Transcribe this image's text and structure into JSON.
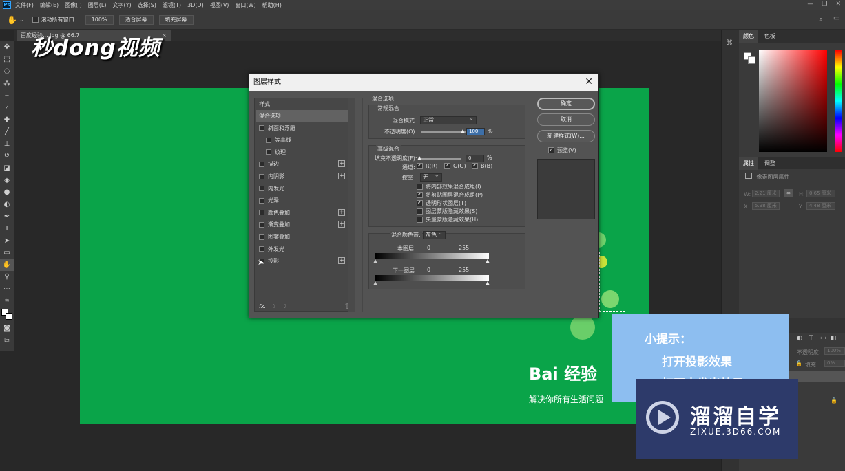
{
  "menubar": {
    "app_icon": "Ps",
    "items": [
      "文件(F)",
      "编辑(E)",
      "图像(I)",
      "图层(L)",
      "文字(Y)",
      "选择(S)",
      "滤镜(T)",
      "3D(D)",
      "视图(V)",
      "窗口(W)",
      "帮助(H)"
    ]
  },
  "options_bar": {
    "scroll_all_label": "滚动所有窗口",
    "zoom_value": "100%",
    "fit_screen": "适合屏幕",
    "fill_screen": "填充屏幕"
  },
  "document_tab": {
    "label": "百度经验... jpg @ 66.7",
    "close": "×"
  },
  "watermark": {
    "text": "秒dong视频"
  },
  "canvas": {
    "brand_text": "Bai 经验",
    "slogan": "解决你所有生活问题"
  },
  "right_panel": {
    "color_tabs": [
      "颜色",
      "色板"
    ],
    "prop_tabs": [
      "属性",
      "调整"
    ],
    "prop_title": "像素图层属性",
    "fields": [
      {
        "label": "W:",
        "value": "2.21 厘米"
      },
      {
        "label": "H:",
        "value": "0.65 厘米"
      },
      {
        "label": "X:",
        "value": "5.98 厘米"
      },
      {
        "label": "Y:",
        "value": "4.48 厘米"
      }
    ],
    "layer_opacity_label": "不透明度:",
    "layer_opacity_value": "100%",
    "fill_label": "填充:",
    "fill_value": "0%"
  },
  "dialog": {
    "title": "图层样式",
    "styles_header": "样式",
    "styles": [
      {
        "label": "混合选项",
        "checkbox": false,
        "plus": false,
        "indent": 0,
        "selected": true
      },
      {
        "label": "斜面和浮雕",
        "checkbox": true,
        "plus": false,
        "indent": 0
      },
      {
        "label": "等高线",
        "checkbox": true,
        "plus": false,
        "indent": 1
      },
      {
        "label": "纹理",
        "checkbox": true,
        "plus": false,
        "indent": 1
      },
      {
        "label": "描边",
        "checkbox": true,
        "plus": true,
        "indent": 0
      },
      {
        "label": "内阴影",
        "checkbox": true,
        "plus": true,
        "indent": 0
      },
      {
        "label": "内发光",
        "checkbox": true,
        "plus": false,
        "indent": 0
      },
      {
        "label": "光泽",
        "checkbox": true,
        "plus": false,
        "indent": 0
      },
      {
        "label": "颜色叠加",
        "checkbox": true,
        "plus": true,
        "indent": 0
      },
      {
        "label": "渐变叠加",
        "checkbox": true,
        "plus": true,
        "indent": 0
      },
      {
        "label": "图案叠加",
        "checkbox": true,
        "plus": false,
        "indent": 0
      },
      {
        "label": "外发光",
        "checkbox": true,
        "plus": false,
        "indent": 0
      },
      {
        "label": "投影",
        "checkbox": true,
        "plus": true,
        "indent": 0
      }
    ],
    "fx_label": "fx.",
    "blend_options_title": "混合选项",
    "general_blend": {
      "title": "常规混合",
      "mode_label": "混合模式:",
      "mode_value": "正常",
      "opacity_label": "不透明度(O):",
      "opacity_value": "100",
      "opacity_unit": "%"
    },
    "advanced_blend": {
      "title": "高级混合",
      "fill_opacity_label": "填充不透明度(F):",
      "fill_opacity_value": "0",
      "fill_opacity_unit": "%",
      "channels_label": "通道:",
      "channels": [
        "R(R)",
        "G(G)",
        "B(B)"
      ],
      "knockout_label": "挖空:",
      "knockout_value": "无",
      "options": [
        {
          "label": "将内部效果混合成组(I)",
          "checked": false
        },
        {
          "label": "将剪贴图层混合成组(P)",
          "checked": true
        },
        {
          "label": "透明形状图层(T)",
          "checked": true
        },
        {
          "label": "图层蒙版隐藏效果(S)",
          "checked": false
        },
        {
          "label": "矢量蒙版隐藏效果(H)",
          "checked": false
        }
      ]
    },
    "blend_if": {
      "label": "混合颜色带:",
      "value": "灰色",
      "this_layer": "本图层:",
      "underlying": "下一图层:",
      "min": "0",
      "max": "255"
    },
    "buttons": {
      "ok": "确定",
      "cancel": "取消",
      "new_style": "新建样式(W)...",
      "preview": "预览(V)"
    }
  },
  "tip": {
    "title": "小提示：",
    "line1": "打开投影效果",
    "line2": "打开内发光效果"
  },
  "logo": {
    "text": "溜溜自学",
    "url": "ZIXUE.3D66.COM"
  }
}
